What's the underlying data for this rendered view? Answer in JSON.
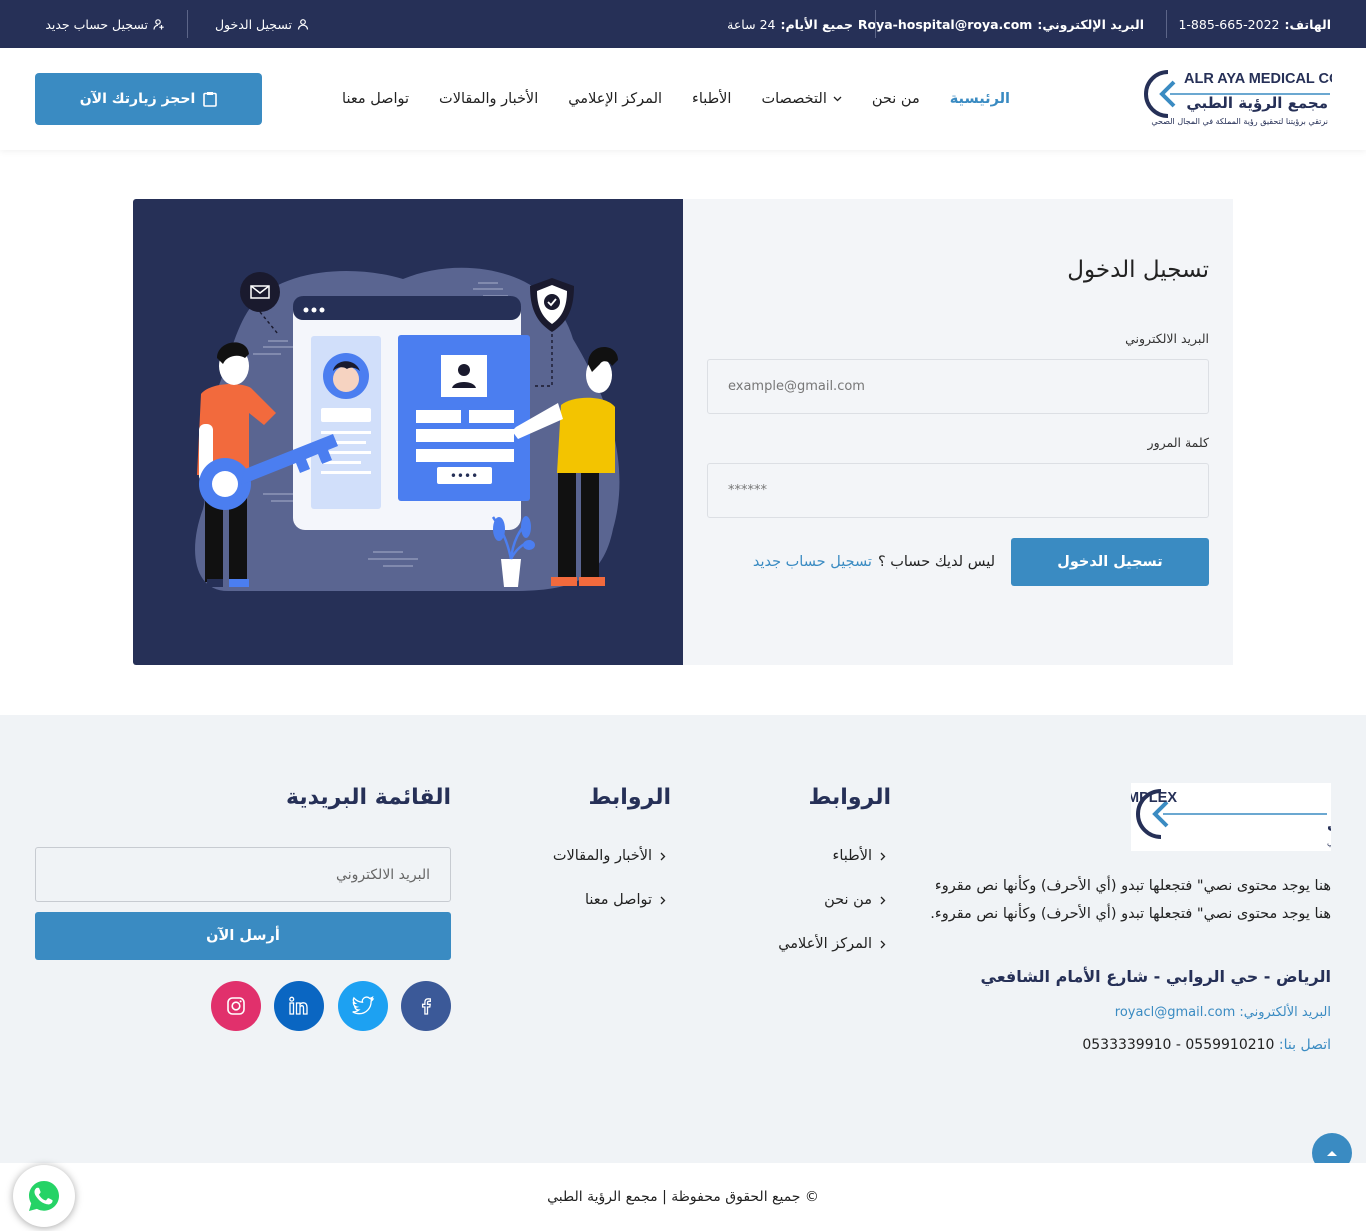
{
  "topbar": {
    "phone_key": "الهاتف:",
    "phone_value": "1-885-665-2022",
    "email_key": "البريد الإلكتروني:",
    "email_value": "Roya-hospital@roya.com",
    "days_key": "جميع الأيام:",
    "days_value": "24 ساعة",
    "login": "تسجيل الدخول",
    "register": "تسجيل حساب جديد"
  },
  "logo": {
    "en": "ALR AYA MEDICAL COMPLEX",
    "ar": "مجمع الرؤية الطبي",
    "tagline": "نرتقي برؤيتنا لتحقيق رؤية المملكة في المجال الصحي"
  },
  "nav": {
    "home": "الرئيسية",
    "about": "من نحن",
    "specialties": "التخصصات",
    "doctors": "الأطباء",
    "media": "المركز الإعلامي",
    "news": "الأخبار والمقالات",
    "contact": "تواصل معنا"
  },
  "cta": {
    "label": "احجز زيارتك الآن"
  },
  "login": {
    "title": "تسجيل الدخول",
    "email_label": "البريد الالكتروني",
    "email_placeholder": "example@gmail.com",
    "password_label": "كلمة المرور",
    "password_placeholder": "******",
    "submit": "تسجيل الدخول",
    "no_account": "ليس لديك حساب ؟",
    "register_link": "تسجيل حساب جديد"
  },
  "footer": {
    "about": "هنا يوجد محتوى نصي\" فتجعلها تبدو (أي الأحرف) وكأنها نص مقروء هنا يوجد محتوى نصي\" فتجعلها تبدو (أي الأحرف) وكأنها نص مقروء.",
    "address": "الرياض - حي الروابي - شارع الأمام الشافعي",
    "email_key": "البريد الألكتروني:",
    "email_value": "royacl@gmail.com",
    "phone_key": "اتصل بنا:",
    "phone_value": "0559910210 - 0533339910",
    "col1_title": "الروابط",
    "col1_links": [
      "الأطباء",
      "من نحن",
      "المركز الأعلامي"
    ],
    "col2_title": "الروابط",
    "col2_links": [
      "الأخبار والمقالات",
      "تواصل معنا"
    ],
    "newsletter_title": "القائمة البريدية",
    "newsletter_placeholder": "البريد الالكتروني",
    "newsletter_button": "أرسل الآن",
    "copyright": "© جميع الحقوق محفوظة | مجمع الرؤية الطبي"
  },
  "social": {
    "facebook_color": "#3b5998",
    "twitter_color": "#1da1f2",
    "linkedin_color": "#0a66c2",
    "instagram_color": "#e1306c"
  },
  "colors": {
    "navy": "#263057",
    "accent": "#3a8bc2",
    "whatsapp": "#25d366"
  }
}
